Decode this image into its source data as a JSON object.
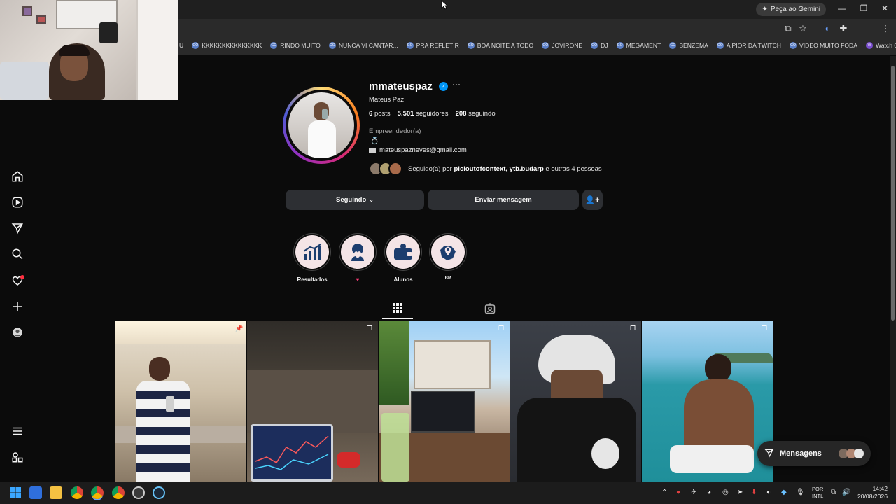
{
  "browser": {
    "gemini_label": "Peça ao Gemini",
    "bookmarks": [
      "U",
      "KKKKKKKKKKKKKKK",
      "RINDO MUITO",
      "NUNCA VI CANTAR...",
      "PRA REFLETIR",
      "BOA NOITE A TODO",
      "JOVIRONE",
      "DJ",
      "MEGAMENT",
      "BENZEMA",
      "A PIOR DA TWITCH",
      "VIDEO MUITO FODA",
      "Watch 0129 | Strea..."
    ]
  },
  "profile": {
    "username": "mmateuspaz",
    "full_name": "Mateus Paz",
    "posts_count": "6",
    "posts_label": "posts",
    "followers_count": "5.501",
    "followers_label": "seguidores",
    "following_count": "208",
    "following_label": "seguindo",
    "category": "Empreendedor(a)",
    "bio_ring": "💍",
    "email": "mateuspazneves@gmail.com",
    "followed_by_prefix": "Seguido(a) por",
    "followed_by_names": "picioutofcontext, ytb.budarp",
    "followed_by_suffix": "e outras 4 pessoas",
    "more_glyph": "···"
  },
  "actions": {
    "following_label": "Seguindo",
    "message_label": "Enviar mensagem",
    "add_user_glyph": "+"
  },
  "highlights": [
    {
      "label": "Resultados",
      "icon": "bar-chart-icon"
    },
    {
      "label": "♥",
      "icon": "couple-heart-icon"
    },
    {
      "label": "Alunos",
      "icon": "wallet-icon"
    },
    {
      "label": "BR",
      "icon": "map-pin-icon"
    }
  ],
  "messages_pill": {
    "label": "Mensagens"
  },
  "taskbar": {
    "lang_top": "POR",
    "lang_bottom": "INTL",
    "time": "14:42",
    "date": "20/08/2026"
  },
  "colors": {
    "background": "#0b0b0b",
    "button": "#2d2f33",
    "verified": "#0095f6",
    "notification": "#ff3040"
  }
}
